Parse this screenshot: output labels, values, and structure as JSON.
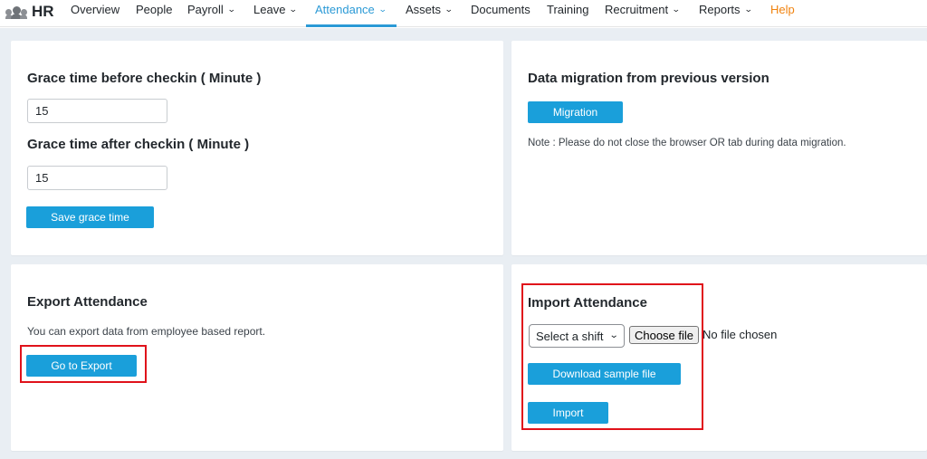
{
  "brand": {
    "icon": "people-icon",
    "name": "HR"
  },
  "nav": {
    "items": [
      {
        "label": "Overview",
        "chevron": false
      },
      {
        "label": "People",
        "chevron": false
      },
      {
        "label": "Payroll",
        "chevron": true
      },
      {
        "label": "Leave",
        "chevron": true
      },
      {
        "label": "Attendance",
        "chevron": true,
        "active": true
      },
      {
        "label": "Assets",
        "chevron": true
      },
      {
        "label": "Documents",
        "chevron": false
      },
      {
        "label": "Training",
        "chevron": false
      },
      {
        "label": "Recruitment",
        "chevron": true
      },
      {
        "label": "Reports",
        "chevron": true
      },
      {
        "label": "Help",
        "chevron": false,
        "highlight": "#f0820e"
      }
    ],
    "chevron_glyph": "⌄",
    "active_color": "#2b9ad6"
  },
  "grace": {
    "before_title": "Grace time before checkin ( Minute )",
    "before_value": "15",
    "after_title": "Grace time after checkin ( Minute )",
    "after_value": "15",
    "save_label": "Save grace time"
  },
  "migration": {
    "title": "Data migration from previous version",
    "button_label": "Migration",
    "note": "Note : Please do not close the browser OR tab during data migration."
  },
  "export": {
    "title": "Export Attendance",
    "description": "You can export data from employee based report.",
    "button_label": "Go to Export"
  },
  "import": {
    "title": "Import Attendance",
    "shift_select": "Select a shift",
    "choose_file_label": "Choose file",
    "no_file_text": "No file chosen",
    "sample_label": "Download sample file",
    "import_label": "Import"
  },
  "colors": {
    "button": "#1a9fda",
    "highlight_box": "#e0121b",
    "background": "#e9eef3"
  }
}
